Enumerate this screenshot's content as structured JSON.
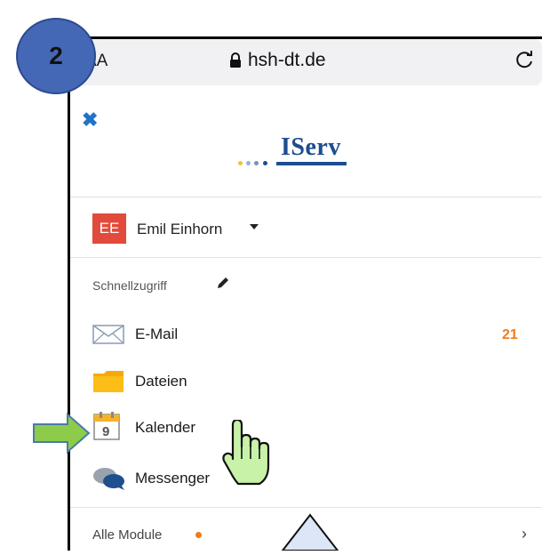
{
  "step": {
    "number": "2"
  },
  "browser": {
    "text_size_label": "AA",
    "url": "hsh-dt.de",
    "icons": [
      "lock-icon",
      "reload-icon"
    ]
  },
  "app": {
    "logo_text": "IServ",
    "close_icon": "close-icon"
  },
  "user": {
    "initials": "EE",
    "name": "Emil Einhorn"
  },
  "quick_access": {
    "label": "Schnellzugriff",
    "items": [
      {
        "label": "E-Mail",
        "icon": "mail-icon",
        "count": "21"
      },
      {
        "label": "Dateien",
        "icon": "folder-icon"
      },
      {
        "label": "Kalender",
        "icon": "calendar-icon",
        "icon_text": "9"
      },
      {
        "label": "Messenger",
        "icon": "chat-icon"
      }
    ]
  },
  "all_modules": {
    "label": "Alle Module"
  },
  "colors": {
    "accent_blue": "#1d4d8f",
    "badge_orange": "#ef7d1a",
    "avatar_red": "#e24a3b",
    "step_badge_blue": "#4468b6",
    "arrow_green": "#8ccc4a",
    "hand_green": "#c8f2a8"
  }
}
